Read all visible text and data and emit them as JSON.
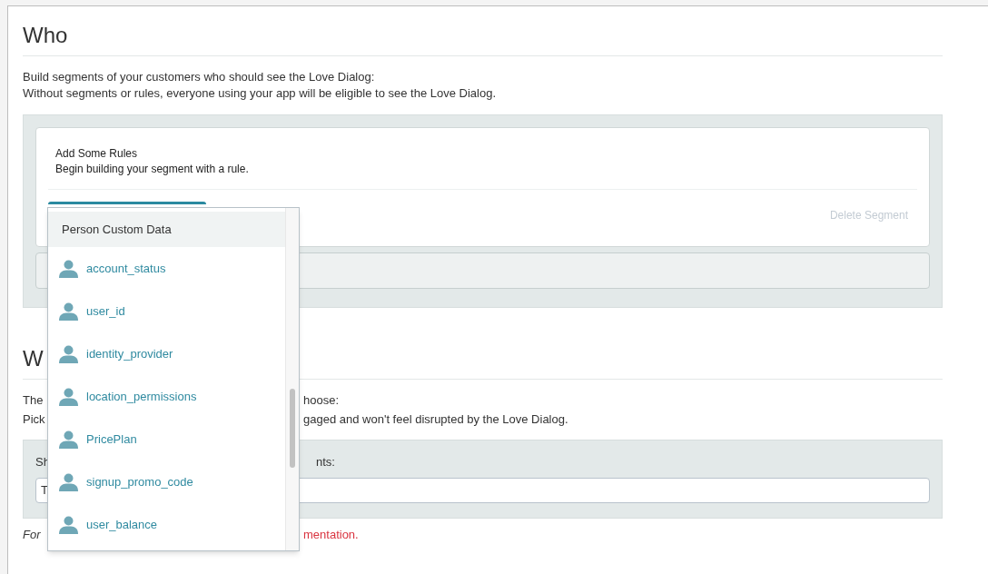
{
  "who": {
    "title": "Who",
    "description": [
      "Build segments of your customers who should see the Love Dialog:",
      "Without segments or rules, everyone using your app will be eligible to see the Love Dialog."
    ],
    "segment": {
      "title": "Add Some Rules",
      "subtitle": "Begin building your segment with a rule.",
      "delete_label": "Delete Segment"
    }
  },
  "when": {
    "title": "W",
    "lines": [
      {
        "left": "The",
        "right": "hoose:"
      },
      {
        "left": "Pick",
        "right": "gaged and won't feel disrupted by the Love Dialog."
      }
    ],
    "label": {
      "left": "Sh",
      "right": "nts:"
    },
    "input_value": "T",
    "note": {
      "left": "For",
      "right": "mentation."
    }
  },
  "dropdown": {
    "header": "Person Custom Data",
    "items": [
      {
        "label": "account_status"
      },
      {
        "label": "user_id"
      },
      {
        "label": "identity_provider"
      },
      {
        "label": "location_permissions"
      },
      {
        "label": "PricePlan"
      },
      {
        "label": "signup_promo_code"
      },
      {
        "label": "user_balance"
      }
    ]
  }
}
